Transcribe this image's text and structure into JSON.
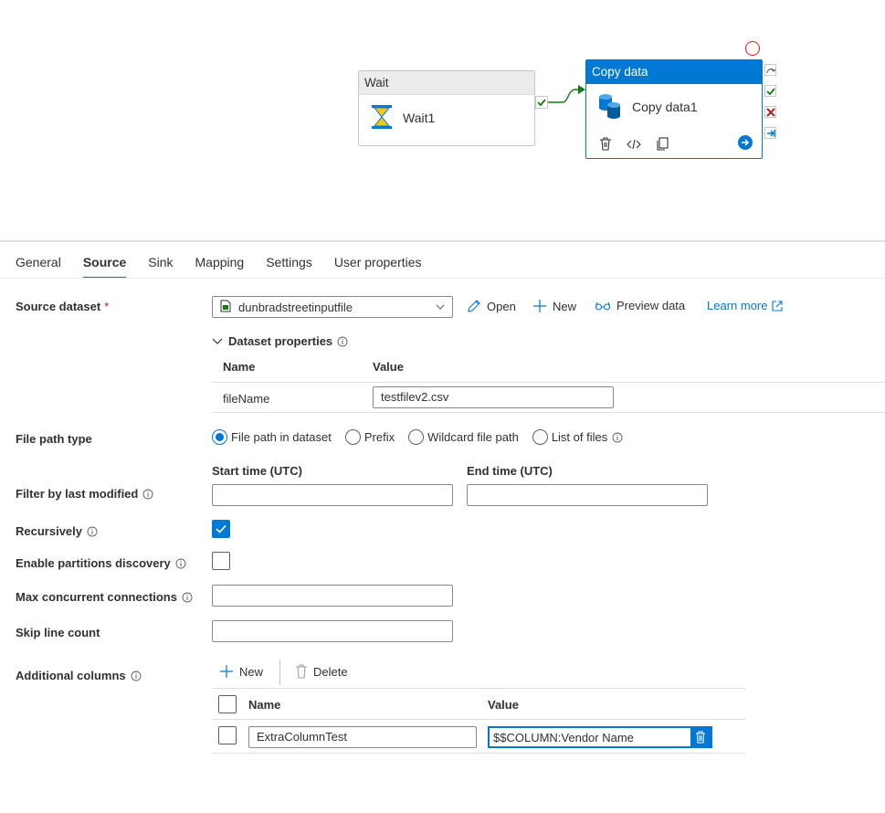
{
  "canvas": {
    "wait_activity": {
      "type_label": "Wait",
      "name": "Wait1"
    },
    "copy_activity": {
      "type_label": "Copy data",
      "name": "Copy data1"
    }
  },
  "tabs": [
    {
      "label": "General",
      "active": false
    },
    {
      "label": "Source",
      "active": true
    },
    {
      "label": "Sink",
      "active": false
    },
    {
      "label": "Mapping",
      "active": false
    },
    {
      "label": "Settings",
      "active": false
    },
    {
      "label": "User properties",
      "active": false
    }
  ],
  "source": {
    "dataset_label": "Source dataset",
    "required_mark": "*",
    "dataset_value": "dunbradstreetinputfile",
    "open_label": "Open",
    "new_label": "New",
    "preview_label": "Preview data",
    "learn_more_label": "Learn more",
    "dataset_properties": {
      "title": "Dataset properties",
      "col_name": "Name",
      "col_value": "Value",
      "row_name": "fileName",
      "row_value": "testfilev2.csv"
    },
    "file_path_type": {
      "label": "File path type",
      "options": [
        "File path in dataset",
        "Prefix",
        "Wildcard file path",
        "List of files"
      ],
      "selected": "File path in dataset"
    },
    "filter_last_modified": {
      "label": "Filter by last modified",
      "start_label": "Start time (UTC)",
      "end_label": "End time (UTC)",
      "start_value": "",
      "end_value": ""
    },
    "recursively": {
      "label": "Recursively",
      "checked": true
    },
    "partitions": {
      "label": "Enable partitions discovery",
      "checked": false
    },
    "max_connections": {
      "label": "Max concurrent connections",
      "value": ""
    },
    "skip_lines": {
      "label": "Skip line count",
      "value": ""
    },
    "additional_columns": {
      "label": "Additional columns",
      "new_label": "New",
      "delete_label": "Delete",
      "col_name": "Name",
      "col_value": "Value",
      "rows": [
        {
          "name": "ExtraColumnTest",
          "value": "$$COLUMN:Vendor Name"
        }
      ]
    }
  },
  "colors": {
    "accent": "#0078d4",
    "success": "#107c10",
    "error": "#a4262c"
  }
}
